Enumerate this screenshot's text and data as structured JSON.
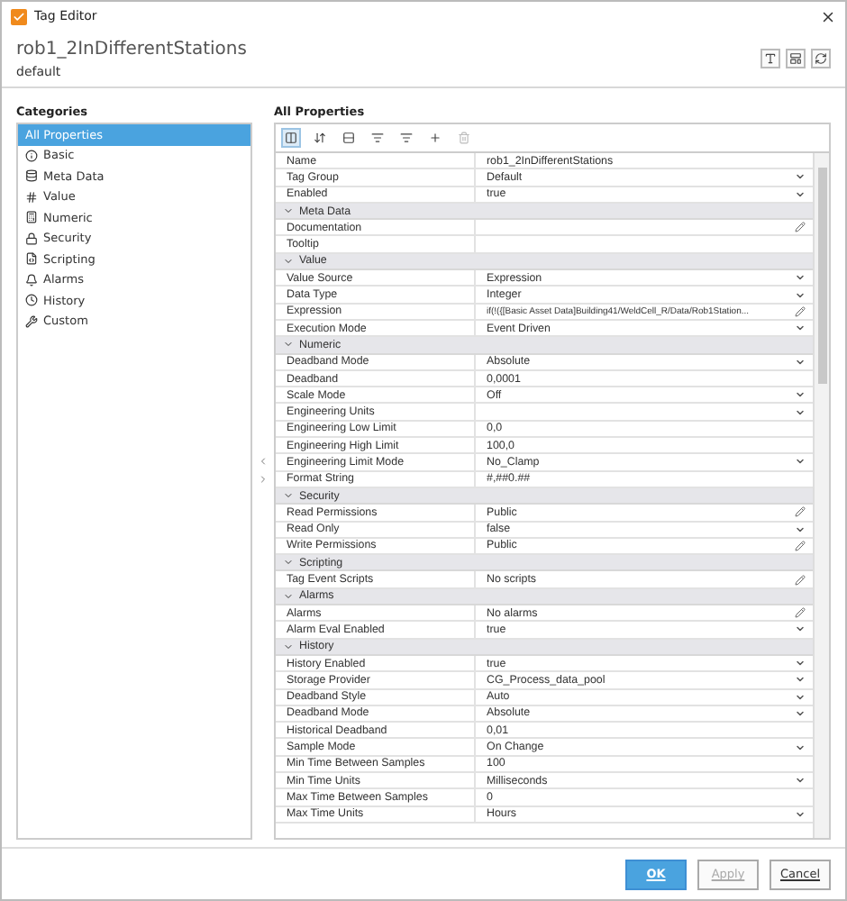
{
  "window": {
    "title": "Tag Editor"
  },
  "header": {
    "tag_name": "rob1_2InDifferentStations",
    "provider": "default"
  },
  "categories": {
    "label": "Categories",
    "items": [
      {
        "label": "All Properties",
        "selected": true
      },
      {
        "label": "Basic",
        "selected": false
      },
      {
        "label": "Meta Data",
        "selected": false
      },
      {
        "label": "Value",
        "selected": false
      },
      {
        "label": "Numeric",
        "selected": false
      },
      {
        "label": "Security",
        "selected": false
      },
      {
        "label": "Scripting",
        "selected": false
      },
      {
        "label": "Alarms",
        "selected": false
      },
      {
        "label": "History",
        "selected": false
      },
      {
        "label": "Custom",
        "selected": false
      }
    ]
  },
  "properties": {
    "label": "All Properties",
    "sections": [
      {
        "rows": [
          {
            "name": "Name",
            "value": "rob1_2InDifferentStations",
            "kind": "text"
          },
          {
            "name": "Tag Group",
            "value": "Default",
            "kind": "dropdown"
          },
          {
            "name": "Enabled",
            "value": "true",
            "kind": "dropdown"
          }
        ]
      },
      {
        "title": "Meta Data",
        "expanded": true,
        "rows": [
          {
            "name": "Documentation",
            "kind": "edit"
          },
          {
            "name": "Tooltip",
            "kind": "text"
          }
        ]
      },
      {
        "title": "Value",
        "expanded": true,
        "rows": [
          {
            "name": "Value Source",
            "value": "Expression",
            "kind": "dropdown"
          },
          {
            "name": "Data Type",
            "value": "Integer",
            "kind": "dropdown"
          },
          {
            "name": "Expression",
            "value": "if(!({[Basic Asset Data]Building41/WeldCell_R/Data/Rob1Station...",
            "kind": "edit"
          },
          {
            "name": "Execution Mode",
            "value": "Event Driven",
            "kind": "dropdown"
          }
        ]
      },
      {
        "title": "Numeric",
        "expanded": true,
        "rows": [
          {
            "name": "Deadband Mode",
            "value": "Absolute",
            "kind": "dropdown"
          },
          {
            "name": "Deadband",
            "value": "0,0001",
            "kind": "text"
          },
          {
            "name": "Scale Mode",
            "value": "Off",
            "kind": "dropdown"
          },
          {
            "name": "Engineering Units",
            "kind": "dropdown"
          },
          {
            "name": "Engineering Low Limit",
            "value": "0,0",
            "kind": "text"
          },
          {
            "name": "Engineering High Limit",
            "value": "100,0",
            "kind": "text"
          },
          {
            "name": "Engineering Limit Mode",
            "value": "No_Clamp",
            "kind": "dropdown"
          },
          {
            "name": "Format String",
            "value": "#,##0.##",
            "kind": "text"
          }
        ]
      },
      {
        "title": "Security",
        "expanded": true,
        "rows": [
          {
            "name": "Read Permissions",
            "value": "Public",
            "kind": "edit"
          },
          {
            "name": "Read Only",
            "value": "false",
            "kind": "dropdown"
          },
          {
            "name": "Write Permissions",
            "value": "Public",
            "kind": "edit"
          }
        ]
      },
      {
        "title": "Scripting",
        "expanded": true,
        "rows": [
          {
            "name": "Tag Event Scripts",
            "value": "No scripts",
            "kind": "edit"
          }
        ]
      },
      {
        "title": "Alarms",
        "expanded": true,
        "rows": [
          {
            "name": "Alarms",
            "value": "No alarms",
            "kind": "edit"
          },
          {
            "name": "Alarm Eval Enabled",
            "value": "true",
            "kind": "dropdown"
          }
        ]
      },
      {
        "title": "History",
        "expanded": true,
        "rows": [
          {
            "name": "History Enabled",
            "value": "true",
            "kind": "dropdown"
          },
          {
            "name": "Storage Provider",
            "value": "CG_Process_data_pool",
            "kind": "dropdown"
          },
          {
            "name": "Deadband Style",
            "value": "Auto",
            "kind": "dropdown"
          },
          {
            "name": "Deadband Mode",
            "value": "Absolute",
            "kind": "dropdown"
          },
          {
            "name": "Historical Deadband",
            "value": "0,01",
            "kind": "text"
          },
          {
            "name": "Sample Mode",
            "value": "On Change",
            "kind": "dropdown"
          },
          {
            "name": "Min Time Between Samples",
            "value": "100",
            "kind": "text"
          },
          {
            "name": "Min Time Units",
            "value": "Milliseconds",
            "kind": "dropdown"
          },
          {
            "name": "Max Time Between Samples",
            "value": "0",
            "kind": "text"
          },
          {
            "name": "Max Time Units",
            "value": "Hours",
            "kind": "dropdown"
          }
        ]
      }
    ]
  },
  "buttons": [
    {
      "label": "OK",
      "kind": "primary",
      "disabled": false
    },
    {
      "label": "Apply",
      "kind": "normal",
      "disabled": true
    },
    {
      "label": "Cancel",
      "kind": "normal",
      "disabled": false
    }
  ]
}
